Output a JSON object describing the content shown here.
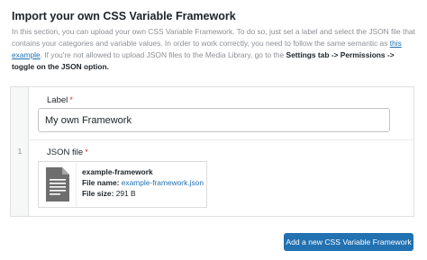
{
  "section": {
    "title": "Import your own CSS Variable Framework",
    "description": {
      "part1": "In this section, you can upload your own CSS Variable Framework. To do so, just set a label and select the JSON file that contains your categories and variable values. In order to work correctly, you need to follow the same semantic as ",
      "link_text": "this example",
      "part2": ". If you're not allowed to upload JSON files to the Media Library, go to the ",
      "bold_text": "Settings tab -> Permissions -> toggle on the JSON option.",
      "part3": ""
    }
  },
  "repeater": {
    "row_number": "1",
    "label_field": {
      "label": "Label",
      "required_mark": "*",
      "value": "My own Framework"
    },
    "json_field": {
      "label": "JSON file",
      "required_mark": "*",
      "file": {
        "title": "example-framework",
        "name_label": "File name:",
        "name_value": "example-framework.json",
        "size_label": "File size:",
        "size_value": "291 B"
      }
    }
  },
  "actions": {
    "add_button_label": "Add a new CSS Variable Framework"
  },
  "colors": {
    "accent": "#2271b1",
    "required": "#d63638",
    "muted_text": "#8c8f94"
  },
  "icons": {
    "file_thumbnail": "document-icon"
  }
}
